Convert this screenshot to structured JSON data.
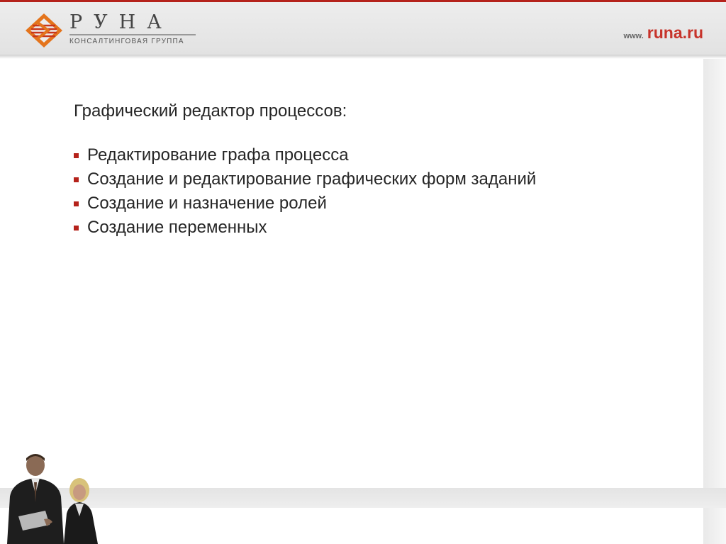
{
  "header": {
    "brand_name": "РУНА",
    "brand_subtitle": "КОНСАЛТИНГОВАЯ ГРУППА",
    "site_prefix": "www.",
    "site_domain": "runa.ru"
  },
  "content": {
    "heading": "Графический редактор процессов:",
    "bullets": [
      "Редактирование графа процесса",
      "Создание и редактирование графических форм заданий",
      "Создание и назначение ролей",
      "Создание переменных"
    ]
  },
  "colors": {
    "accent_red": "#b5221b",
    "header_gray": "#e6e6e6",
    "text": "#262626"
  }
}
